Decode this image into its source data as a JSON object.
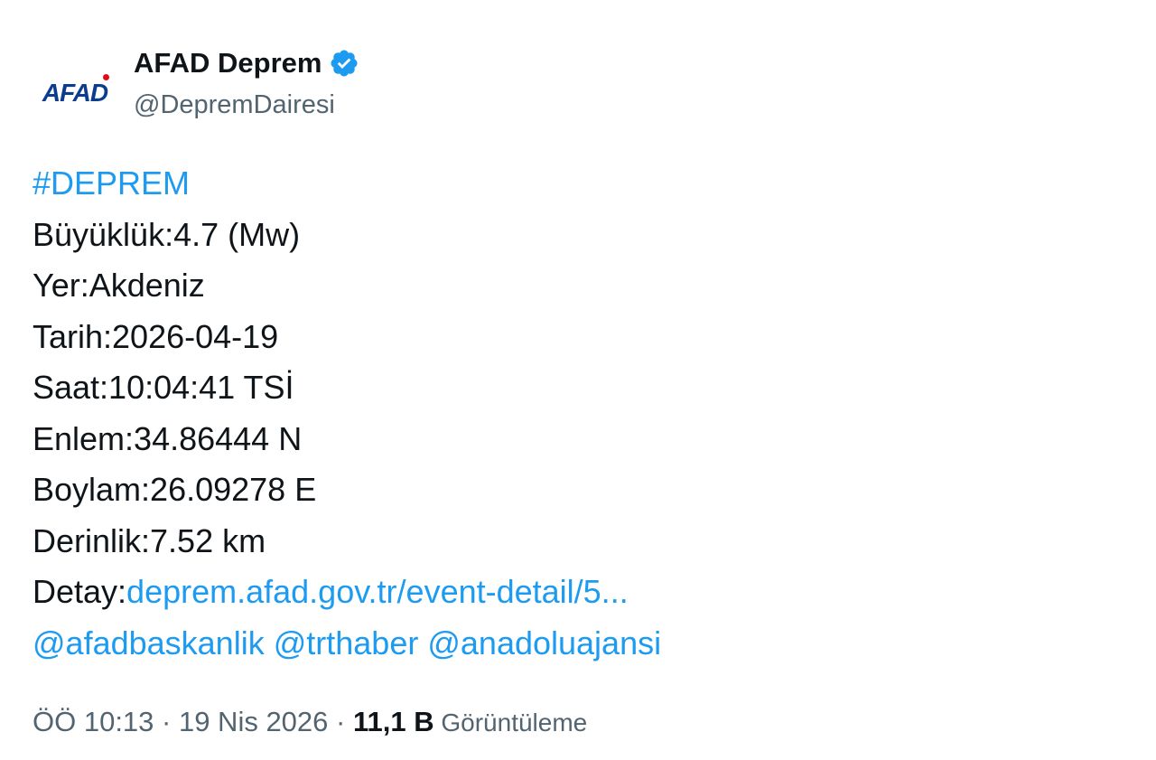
{
  "account": {
    "avatar_text": "AFAD",
    "display_name": "AFAD Deprem",
    "handle": "@DepremDairesi",
    "verified_icon": "verified-badge-icon",
    "verified_color": "#1d9bf0",
    "brand_color": "#0a3d8f",
    "brand_dot_color": "#e30a17"
  },
  "tweet": {
    "hashtag": "#DEPREM",
    "magnitude": "Büyüklük:4.7 (Mw)",
    "location": "Yer:Akdeniz",
    "date": "Tarih:2026-04-19",
    "time": "Saat:10:04:41 TSİ",
    "latitude": "Enlem:34.86444 N",
    "longitude": "Boylam:26.09278 E",
    "depth": "Derinlik:7.52 km",
    "detail_label": "Detay:",
    "detail_link": "deprem.afad.gov.tr/event-detail/5...",
    "mentions": [
      "@afadbaskanlik",
      "@trthaber",
      "@anadoluajansi"
    ],
    "link_color": "#1d9bf0"
  },
  "footer": {
    "timestamp": "ÖÖ 10:13 · 19 Nis 2026 · ",
    "views_count": "11,1 B",
    "views_label": " Görüntüleme"
  }
}
